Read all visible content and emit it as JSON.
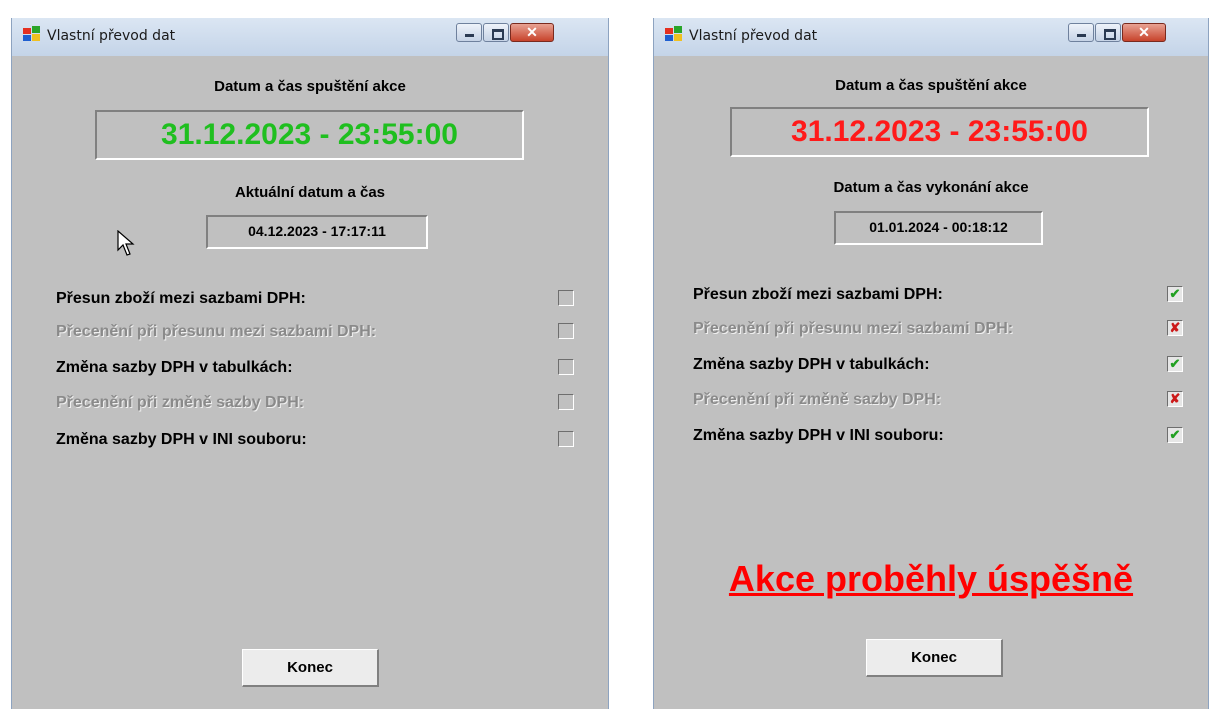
{
  "left_window": {
    "title": "Vlastní převod dat",
    "start_label": "Datum a čas spuštění akce",
    "start_value": "31.12.2023 - 23:55:00",
    "start_color": "#1fbf1f",
    "current_label": "Aktuální datum a čas",
    "current_value": "04.12.2023 - 17:17:11",
    "options": [
      {
        "label": "Přesun zboží mezi sazbami DPH:",
        "enabled": true,
        "state": "unchecked"
      },
      {
        "label": "Přecenění při přesunu mezi sazbami DPH:",
        "enabled": false,
        "state": "unchecked"
      },
      {
        "label": "Změna sazby DPH v tabulkách:",
        "enabled": true,
        "state": "unchecked"
      },
      {
        "label": "Přecenění při změně sazby DPH:",
        "enabled": false,
        "state": "unchecked"
      },
      {
        "label": "Změna sazby DPH v INI souboru:",
        "enabled": true,
        "state": "unchecked"
      }
    ],
    "close_button": "Konec"
  },
  "right_window": {
    "title": "Vlastní převod dat",
    "start_label": "Datum a čas spuštění akce",
    "start_value": "31.12.2023 - 23:55:00",
    "start_color": "#ff1a1a",
    "exec_label": "Datum a čas vykonání akce",
    "exec_value": "01.01.2024 - 00:18:12",
    "options": [
      {
        "label": "Přesun zboží mezi sazbami DPH:",
        "enabled": true,
        "state": "success"
      },
      {
        "label": "Přecenění při přesunu mezi sazbami DPH:",
        "enabled": false,
        "state": "failed"
      },
      {
        "label": "Změna sazby DPH v tabulkách:",
        "enabled": true,
        "state": "success"
      },
      {
        "label": "Přecenění při změně sazby DPH:",
        "enabled": false,
        "state": "failed"
      },
      {
        "label": "Změna sazby DPH v INI souboru:",
        "enabled": true,
        "state": "success"
      }
    ],
    "success_message": "Akce proběhly úspěšně",
    "success_color": "#ff0000",
    "close_button": "Konec"
  },
  "icons": {
    "check_mark": "✔",
    "cross_mark": "✘",
    "close_glyph": "✕"
  }
}
